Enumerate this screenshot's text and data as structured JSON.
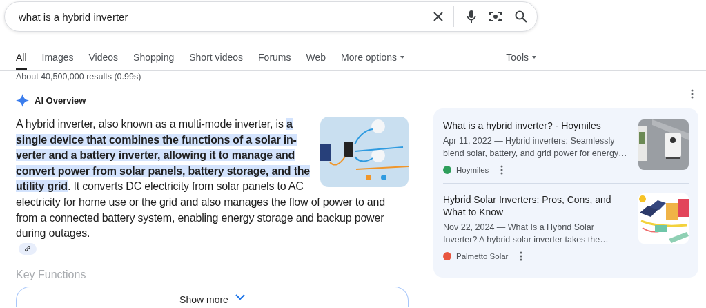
{
  "search": {
    "value": "what is a hybrid inverter"
  },
  "tabs": [
    {
      "label": "All",
      "selected": true,
      "dropdown": false
    },
    {
      "label": "Images",
      "selected": false,
      "dropdown": false
    },
    {
      "label": "Videos",
      "selected": false,
      "dropdown": false
    },
    {
      "label": "Shopping",
      "selected": false,
      "dropdown": false
    },
    {
      "label": "Short videos",
      "selected": false,
      "dropdown": false
    },
    {
      "label": "Forums",
      "selected": false,
      "dropdown": false
    },
    {
      "label": "Web",
      "selected": false,
      "dropdown": false
    },
    {
      "label": "More options",
      "selected": false,
      "dropdown": true
    }
  ],
  "tools": "Tools",
  "result_stats": "About 40,500,000 results (0.99s)",
  "ai_overview": {
    "title": "AI Overview",
    "paragraph": [
      {
        "text": "A hybrid inverter, also known as a multi-mode inverter, is ",
        "highlighted": false
      },
      {
        "text": "a single device that combines the functions of a solar in-verter and a battery inverter, allowing it to manage and convert power from solar panels, battery storage, and the utility grid",
        "highlighted": true
      },
      {
        "text": ". It converts DC electricity from solar panels to AC electricity for home use or the grid and also manages the flow of power to and from a connected battery system, enabling energy storage and backup power during outages.",
        "highlighted": false
      }
    ],
    "next_heading": "Key Functions",
    "show_more": "Show more"
  },
  "sources": [
    {
      "title": "What is a hybrid inverter? - Hoymiles",
      "snippet": "Apr 11, 2022 — Hybrid inverters: Seamlessly blend solar, battery, and grid power for energy…",
      "site": "Hoymiles",
      "color": "#2e9e5b",
      "kind": "device"
    },
    {
      "title": "Hybrid Solar Inverters: Pros, Cons, and What to Know",
      "snippet": "Nov 22, 2024 — What Is a Hybrid Solar Inverter? A hybrid solar inverter takes the…",
      "site": "Palmetto Solar",
      "color": "#e8553f",
      "kind": "solar"
    }
  ]
}
